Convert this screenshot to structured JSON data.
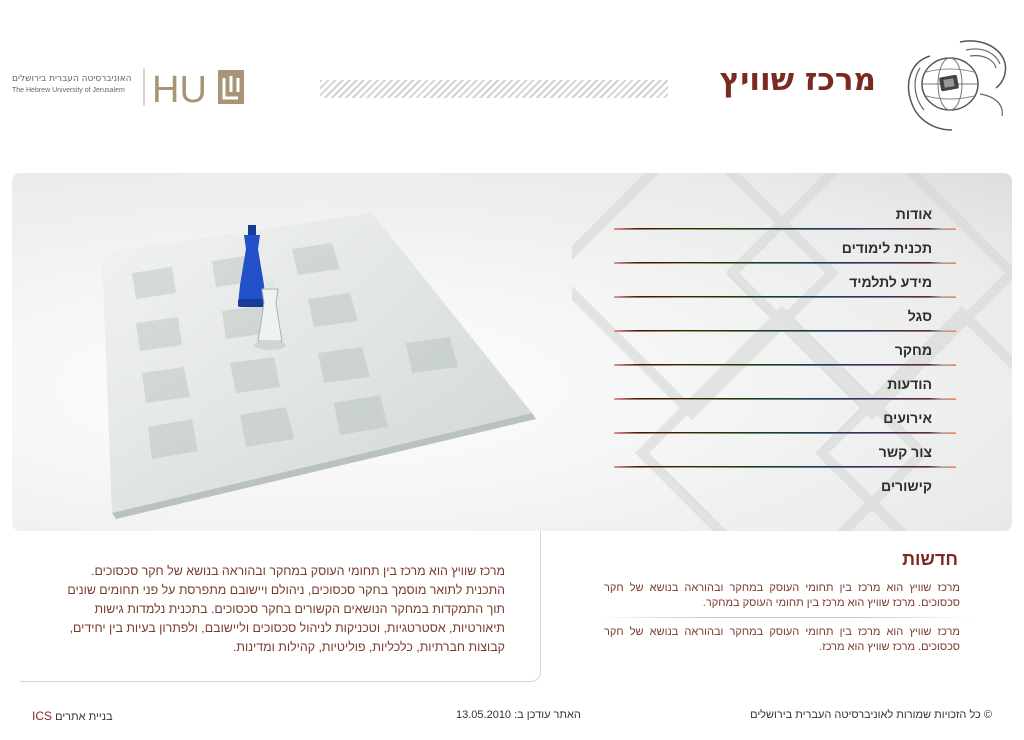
{
  "header": {
    "site_title": "מרכז שוויץ",
    "university_hebrew": "האוניברסיטה העברית בירושלים",
    "university_english": "The Hebrew University of Jerusalem",
    "hu_logo_text": "HU",
    "logo_icon": "hands-globe-icon"
  },
  "nav": {
    "items": [
      {
        "label": "אודות"
      },
      {
        "label": "תכנית לימודים"
      },
      {
        "label": "מידע לתלמיד"
      },
      {
        "label": "סגל"
      },
      {
        "label": "מחקר"
      },
      {
        "label": "הודעות"
      },
      {
        "label": "אירועים"
      },
      {
        "label": "צור קשר"
      },
      {
        "label": "קישורים"
      }
    ]
  },
  "news": {
    "title": "חדשות",
    "items": [
      {
        "text": "מרכז שוויץ הוא מרכז בין תחומי העוסק במחקר ובהוראה בנושא של חקר סכסוכים. מרכז שוויץ הוא מרכז בין תחומי העוסק במחקר."
      },
      {
        "text": "מרכז שוויץ הוא מרכז בין תחומי העוסק במחקר ובהוראה בנושא של חקר סכסוכים. מרכז שוויץ הוא מרכז."
      }
    ]
  },
  "intro": {
    "text": "מרכז שוויץ הוא מרכז בין תחומי העוסק במחקר ובהוראה בנושא של חקר סכסוכים. התכנית לתואר מוסמך בחקר סכסוכים, ניהולם ויישובם מתפרסת על פני תחומים שונים תוך התמקדות במחקר הנושאים הקשורים בחקר סכסוכים.   בתכנית נלמדות גישות תיאורטיות, אסטרטגיות, וטכניקות לניהול סכסוכים וליישובם, ולפתרון בעיות בין יחידים, קבוצות חברתיות, כלכליות, פוליטיות, קהילות ומדינות."
  },
  "footer": {
    "copyright": "© כל הזכויות שמורות לאוניברסיטה העברית בירושלים",
    "updated": "האתר עודכן ב: 13.05.2010",
    "built_by_label": "בניית אתרים",
    "built_by_company": "ICS"
  },
  "colors": {
    "brand": "#7b2a22",
    "text": "#7b3a30",
    "hu_logo": "#a89477"
  }
}
